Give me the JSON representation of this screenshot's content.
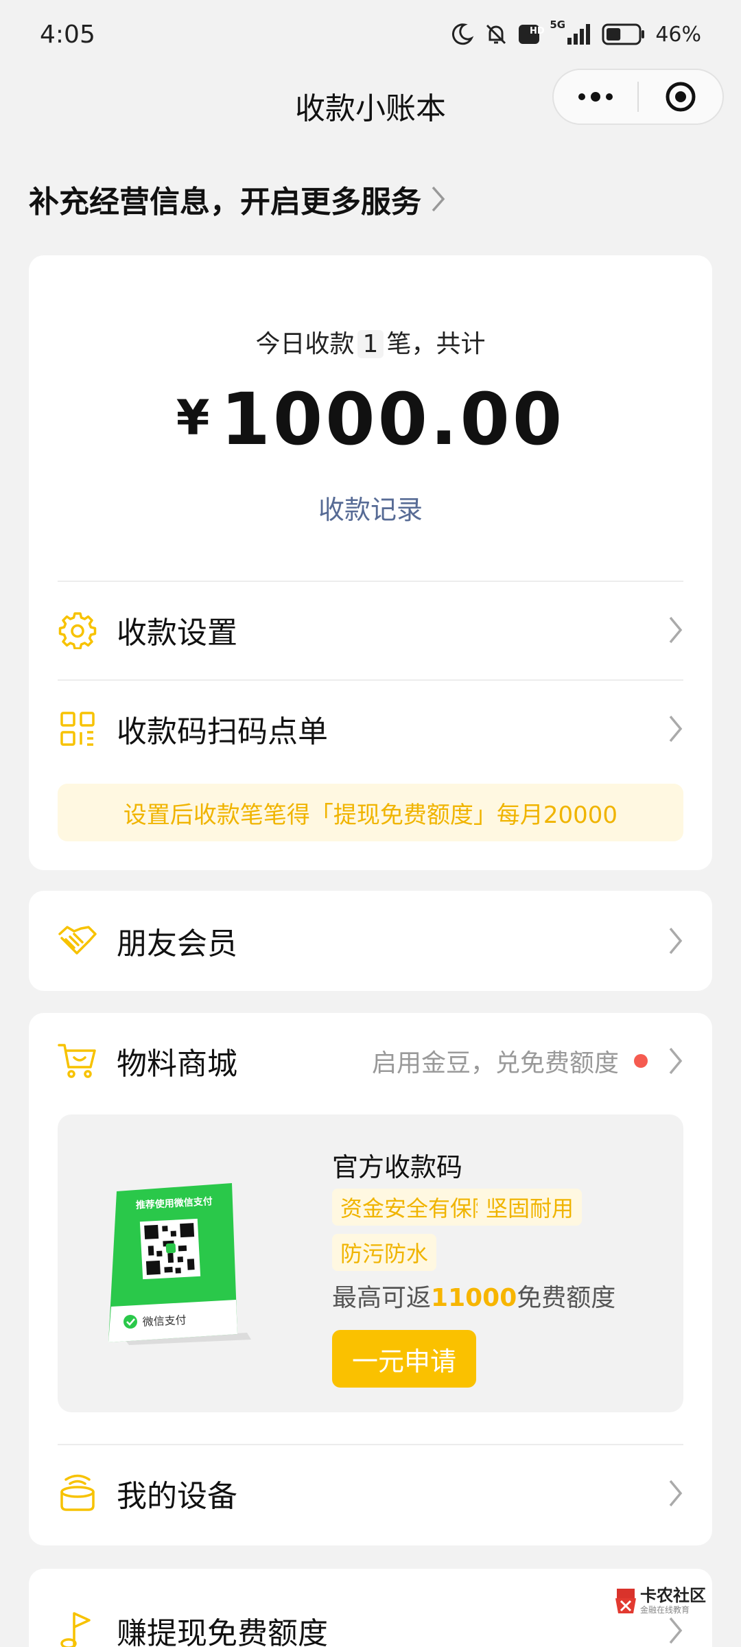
{
  "status_bar": {
    "time": "4:05",
    "network": "5G",
    "hd": "HD",
    "battery_percent": "46%",
    "battery_level": 0.46
  },
  "nav": {
    "title": "收款小账本"
  },
  "banner": {
    "text": "补充经营信息，开启更多服务"
  },
  "summary": {
    "count_prefix": "今日收款",
    "count": "1",
    "count_suffix": "笔，共计",
    "currency": "¥",
    "amount": "1000.00",
    "records_link": "收款记录"
  },
  "menu": {
    "settings": "收款设置",
    "qr_order": "收款码扫码点单",
    "promo": "设置后收款笔笔得「提现免费额度」每月20000",
    "member": "朋友会员",
    "mall": "物料商城",
    "mall_hint": "启用金豆，兑免费额度",
    "device": "我的设备",
    "earn": "赚提现免费额度"
  },
  "product": {
    "title": "官方收款码",
    "tags": [
      "资金安全有保障",
      "坚固耐用",
      "防污防水"
    ],
    "return_prefix": "最高可返",
    "return_amount": "11000",
    "return_suffix": "免费额度",
    "apply_button": "一元申请",
    "stand_header": "推荐使用微信支付",
    "stand_brand": "微信支付"
  },
  "watermark": {
    "main": "卡农社区",
    "sub": "金融在线教育"
  },
  "colors": {
    "accent_yellow": "#fac100",
    "link_blue": "#576b95",
    "red_dot": "#f55b50",
    "wechat_green": "#2ac84a"
  }
}
